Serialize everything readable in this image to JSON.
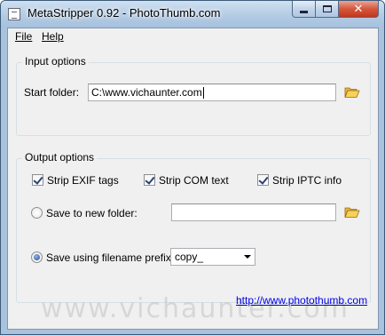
{
  "window": {
    "title": "MetaStripper 0.92 - PhotoThumb.com",
    "close_glyph": "✕"
  },
  "menu": {
    "file": "File",
    "help": "Help"
  },
  "input_options": {
    "legend": "Input options",
    "start_folder_label": "Start folder:",
    "start_folder_value": "C:\\www.vichaunter.com",
    "browse_icon": "folder-open-icon"
  },
  "output_options": {
    "legend": "Output options",
    "strip_exif_label": "Strip EXIF tags",
    "strip_exif_checked": true,
    "strip_com_label": "Strip COM text",
    "strip_com_checked": true,
    "strip_iptc_label": "Strip IPTC info",
    "strip_iptc_checked": true,
    "save_new_folder_label": "Save to new folder:",
    "save_new_folder_selected": false,
    "new_folder_value": "",
    "save_prefix_label": "Save using filename prefix:",
    "save_prefix_selected": true,
    "prefix_value": "copy_"
  },
  "footer": {
    "link": "http://www.photothumb.com"
  },
  "watermark": "www.vichaunter.com"
}
